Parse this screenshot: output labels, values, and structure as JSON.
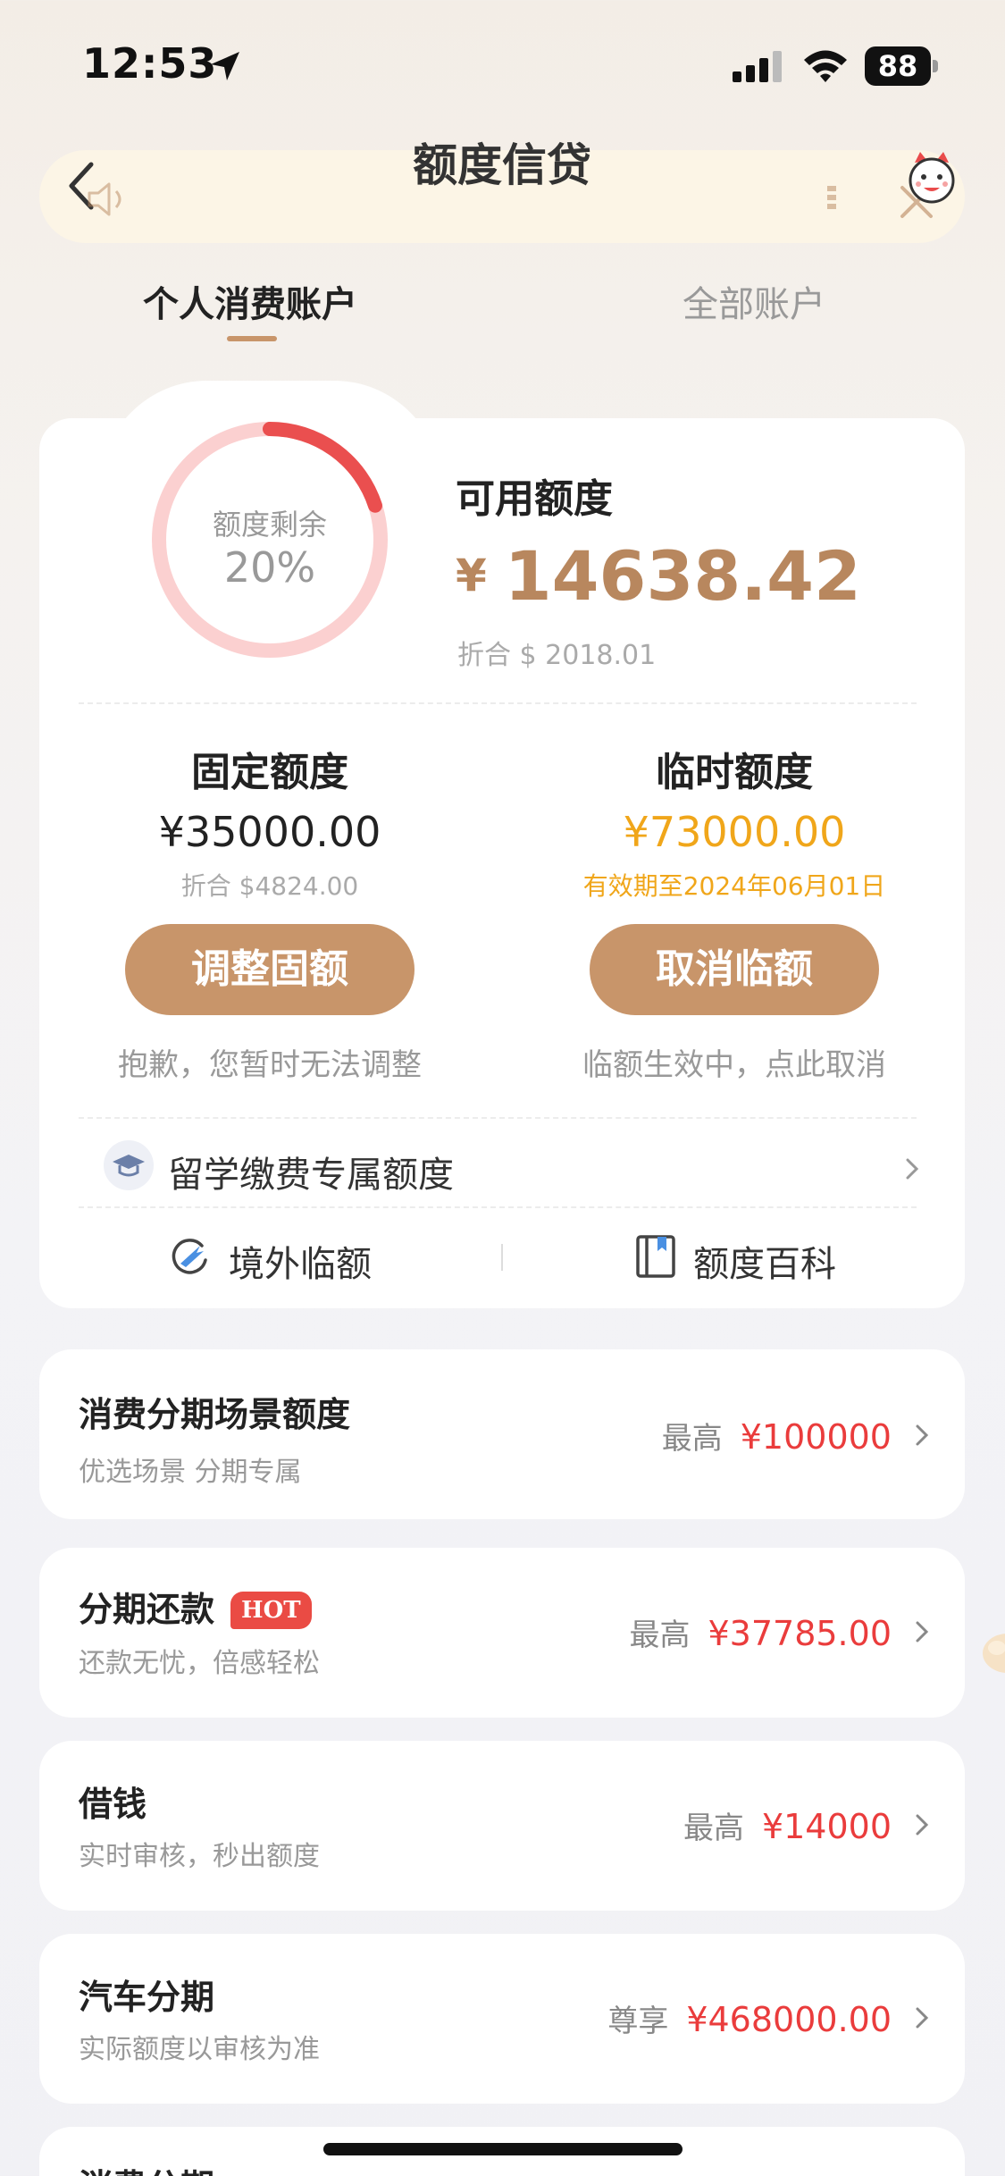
{
  "status_bar": {
    "time": "12:53",
    "battery": "88"
  },
  "header": {
    "title": "额度信贷"
  },
  "tabs": [
    {
      "label": "个人消费账户",
      "active": true
    },
    {
      "label": "全部账户",
      "active": false
    }
  ],
  "overview": {
    "gauge_label": "额度剩余",
    "gauge_percent": "20%",
    "gauge_fraction": 0.2,
    "available_label": "可用额度",
    "currency_symbol": "¥",
    "available_amount": "14638.42",
    "available_usd": "折合 $ 2018.01"
  },
  "fixed_limit": {
    "title": "固定额度",
    "amount": "¥35000.00",
    "usd": "折合 $4824.00",
    "button": "调整固额",
    "note": "抱歉，您暂时无法调整"
  },
  "temp_limit": {
    "title": "临时额度",
    "amount": "¥73000.00",
    "validity": "有效期至2024年06月01日",
    "button": "取消临额",
    "note": "临额生效中，点此取消"
  },
  "study_abroad": {
    "label": "留学缴费专属额度"
  },
  "links": [
    {
      "label": "境外临额",
      "icon": "plane-globe-icon"
    },
    {
      "label": "额度百科",
      "icon": "book-icon"
    }
  ],
  "products": [
    {
      "title": "消费分期场景额度",
      "subtitle": "优选场景 分期专属",
      "prefix": "最高",
      "value": "¥100000",
      "badge": ""
    },
    {
      "title": "分期还款",
      "subtitle": "还款无忧，倍感轻松",
      "prefix": "最高",
      "value": "¥37785.00",
      "badge": "HOT"
    },
    {
      "title": "借钱",
      "subtitle": "实时审核，秒出额度",
      "prefix": "最高",
      "value": "¥14000",
      "badge": ""
    },
    {
      "title": "汽车分期",
      "subtitle": "实际额度以审核为准",
      "prefix": "尊享",
      "value": "¥468000.00",
      "badge": ""
    },
    {
      "title": "消费分期",
      "subtitle": "",
      "prefix": "",
      "value": "",
      "badge": ""
    }
  ],
  "colors": {
    "accent": "#c8956a",
    "amount_gold": "#b8875e",
    "temp_orange": "#f0a61a",
    "price_red": "#ea3c3c",
    "gauge_red": "#ea4f4f",
    "gauge_track": "#fbd0d0"
  }
}
